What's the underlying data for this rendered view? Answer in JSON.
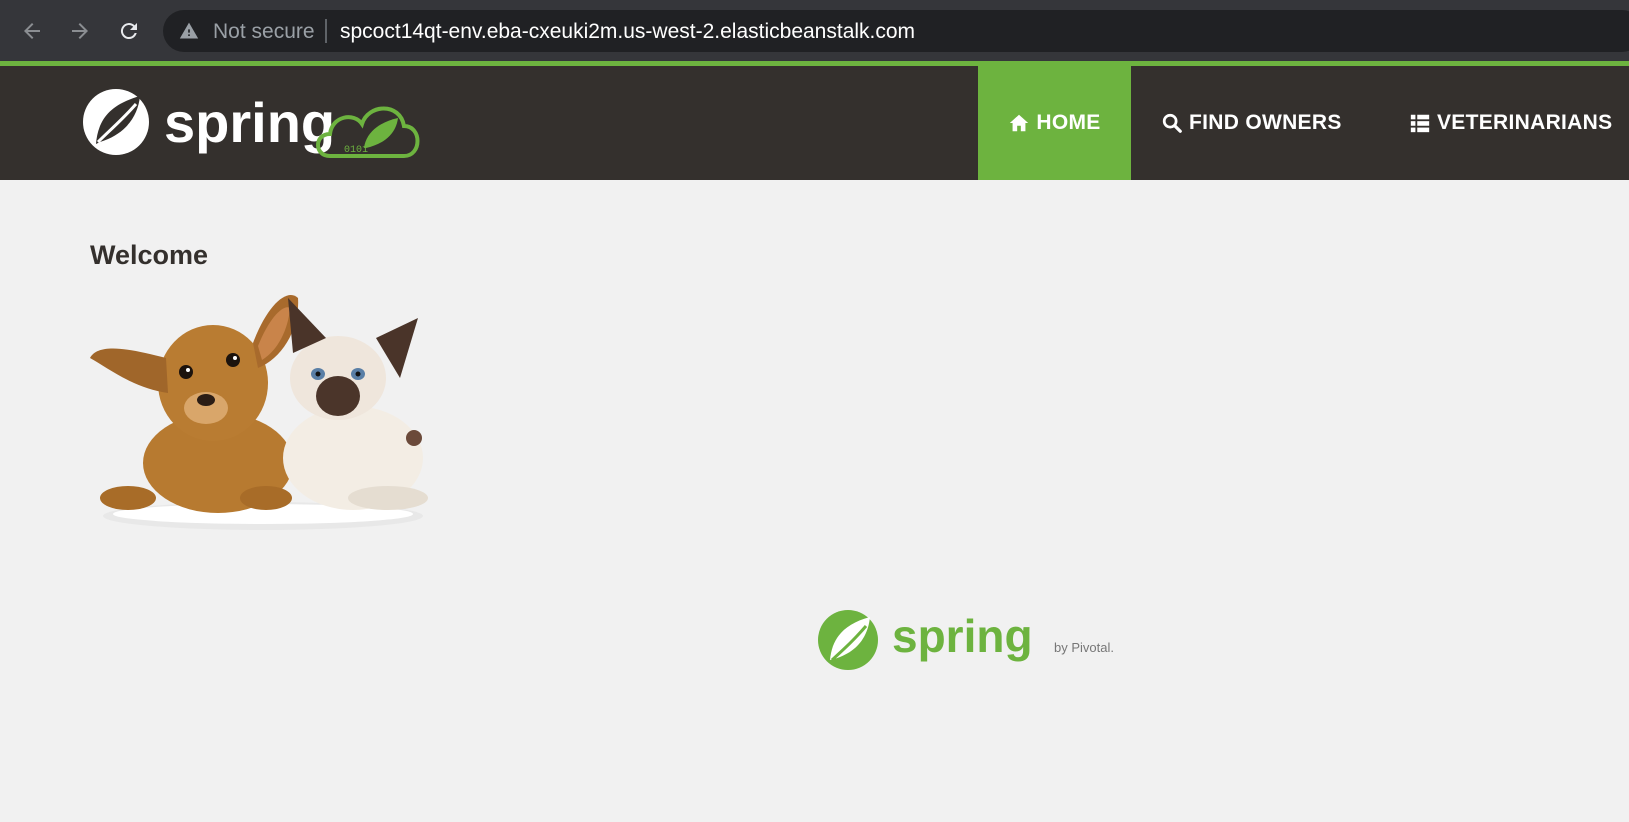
{
  "browser": {
    "security_label": "Not secure",
    "url": "spcoct14qt-env.eba-cxeuki2m.us-west-2.elasticbeanstalk.com",
    "icons": [
      "back-arrow-icon",
      "forward-arrow-icon",
      "reload-icon",
      "warning-icon"
    ]
  },
  "navbar": {
    "brand_logo": "spring",
    "items": [
      {
        "label": "HOME",
        "icon": "home-icon",
        "active": true
      },
      {
        "label": "FIND OWNERS",
        "icon": "search-icon",
        "active": false
      },
      {
        "label": "VETERINARIANS",
        "icon": "list-icon",
        "active": false
      }
    ]
  },
  "main": {
    "heading": "Welcome",
    "image": "pets-dog-and-cat"
  },
  "footer": {
    "logo_text": "spring",
    "logo_byline": "by Pivotal."
  },
  "colors": {
    "accent": "#6db33f",
    "navbar_bg": "#34302d",
    "page_bg": "#f1f1f1"
  }
}
